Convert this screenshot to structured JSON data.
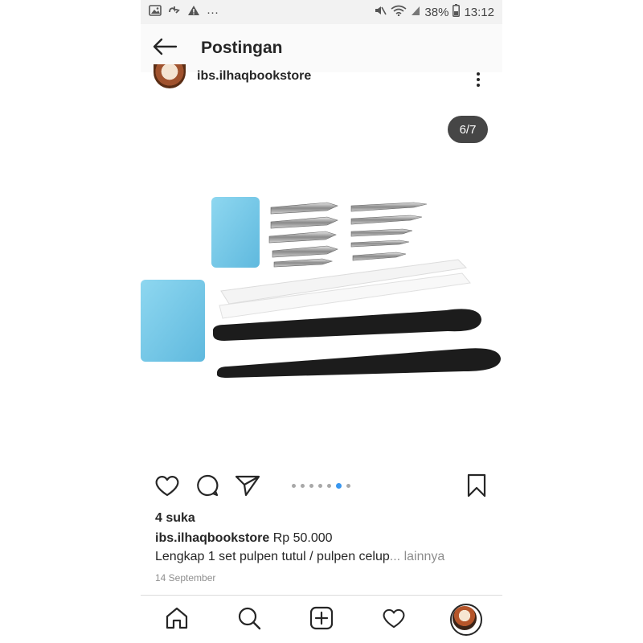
{
  "status_bar": {
    "battery": "38%",
    "time": "13:12",
    "more": "···"
  },
  "app_bar": {
    "title": "Postingan"
  },
  "post": {
    "username": "ibs.ilhaqbookstore",
    "image_counter": "6/7",
    "carousel": {
      "total": 7,
      "current": 6
    },
    "likes": "4 suka",
    "caption_user": "ibs.ilhaqbookstore",
    "caption_price": "Rp 50.000",
    "caption_text": "Lengkap 1 set pulpen tutul / pulpen celup",
    "caption_ellipsis": "...",
    "caption_more": "lainnya",
    "date": "14 September"
  },
  "colors": {
    "accent": "#3897f0",
    "text": "#262626",
    "muted": "#8e8e8e",
    "eraser": "#6ec6e6",
    "holder": "#1c1c1c"
  },
  "icons": {
    "back": "arrow-left-icon",
    "more": "more-vertical-icon",
    "like": "heart-icon",
    "comment": "comment-icon",
    "share": "send-icon",
    "save": "bookmark-icon",
    "home": "home-icon",
    "search": "search-icon",
    "new_post": "add-post-icon",
    "activity": "heart-icon"
  }
}
